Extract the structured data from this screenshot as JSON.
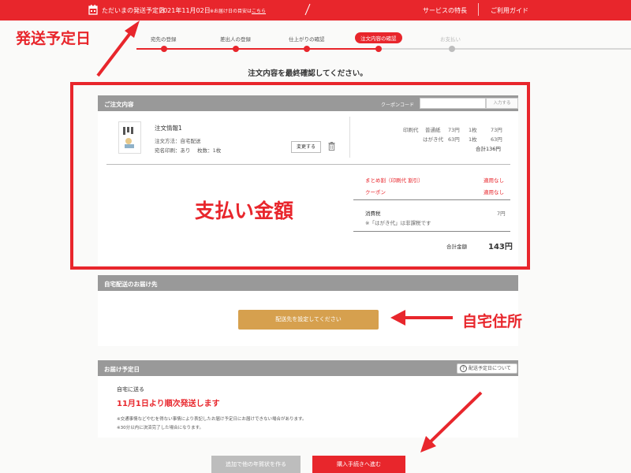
{
  "topbar": {
    "ship_label": "ただいまの発送予定日",
    "ship_date": "2021年11月02日",
    "note": "※お届け日の目安は",
    "note_link": "こちら",
    "link_features": "サービスの特長",
    "link_guide": "ご利用ガイド"
  },
  "steps": [
    {
      "label": "宛先の登録",
      "state": "done"
    },
    {
      "label": "差出人の登録",
      "state": "done"
    },
    {
      "label": "仕上がりの確認",
      "state": "done"
    },
    {
      "label": "注文内容の確認",
      "state": "active"
    },
    {
      "label": "お支払い",
      "state": "todo"
    }
  ],
  "instruction": "注文内容を最終確認してください。",
  "order": {
    "header": "ご注文内容",
    "coupon_label": "クーポンコード",
    "coupon_placeholder": "",
    "coupon_button": "入力する",
    "item_title": "注文情報1",
    "item_method": "注文方法：自宅配送",
    "item_print": "宛名印刷：あり　 枚数：1枚",
    "change_button": "変更する",
    "price_lines": [
      {
        "name": "印刷代",
        "type": "普通紙",
        "unit": "73円",
        "qty": "1枚",
        "amount": "73円"
      },
      {
        "name": "はがき代",
        "type": "",
        "unit": "63円",
        "qty": "1枚",
        "amount": "63円"
      }
    ],
    "subtotal": "合計136円",
    "bulk_discount": "まとめ割（印刷代 割引）",
    "bulk_value": "適用なし",
    "coupon_row": "クーポン",
    "coupon_value": "適用なし",
    "tax_label": "消費税",
    "tax_value": "7円",
    "tax_note": "※「はがき代」は非課税です",
    "total_label": "合計金額",
    "total_value": "143円"
  },
  "delivery": {
    "header": "自宅配送のお届け先",
    "button": "配送先を設定してください"
  },
  "schedule": {
    "header": "お届け予定日",
    "help": "配送予定日について",
    "sub": "自宅に送る",
    "headline": "11月1日より順次発送します",
    "note1": "※交通事情などやむを得ない事情により表記したお届け予定日にお届けできない場合があります。",
    "note2": "※30分以内に決済完了した場合になります。"
  },
  "footer": {
    "btn_more": "追加で他の年賀状を作る",
    "btn_buy": "購入手続きへ進む"
  },
  "annotations": {
    "ship_date": "発送予定日",
    "payment": "支払い金額",
    "address": "自宅住所"
  },
  "colors": {
    "accent": "#e8262c",
    "gold": "#d6a04e",
    "header_gray": "#999999"
  }
}
